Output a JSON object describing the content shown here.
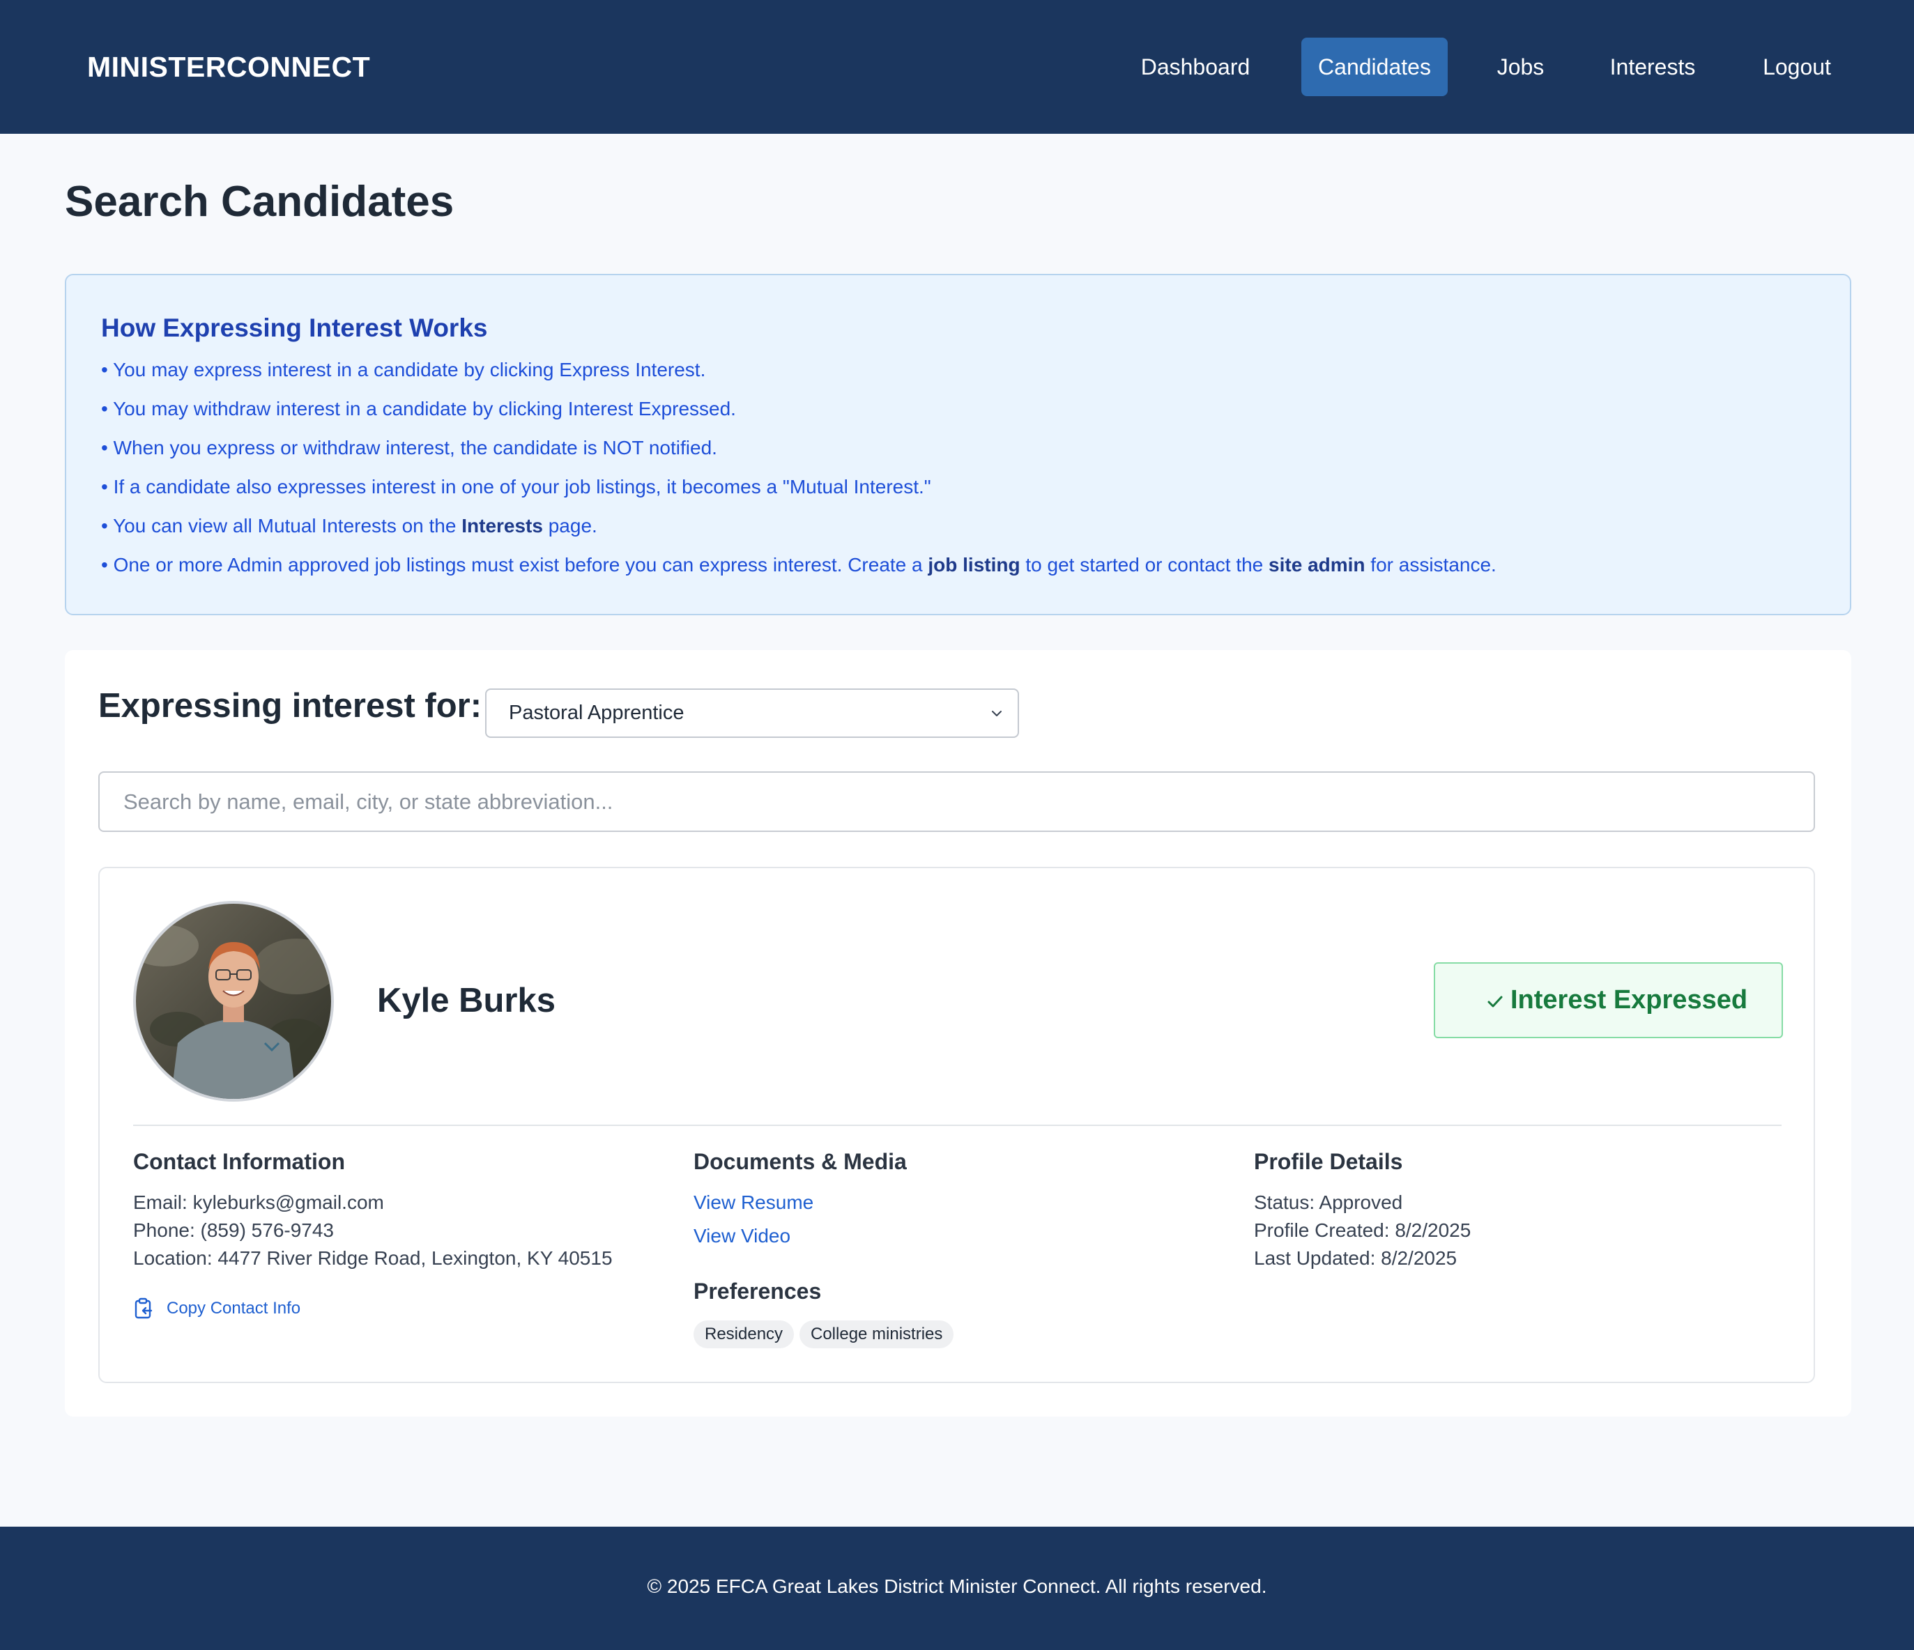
{
  "header": {
    "brand": "MINISTERCONNECT",
    "nav": [
      {
        "label": "Dashboard",
        "active": false
      },
      {
        "label": "Candidates",
        "active": true
      },
      {
        "label": "Jobs",
        "active": false
      },
      {
        "label": "Interests",
        "active": false
      },
      {
        "label": "Logout",
        "active": false
      }
    ],
    "bar_color": "#1b365e",
    "active_color": "#2e6bb0"
  },
  "page": {
    "title": "Search Candidates"
  },
  "info": {
    "title": "How Expressing Interest Works",
    "line1": "• You may express interest in a candidate by clicking Express Interest.",
    "line2": "• You may withdraw interest in a candidate by clicking Interest Expressed.",
    "line3": "• When you express or withdraw interest, the candidate is NOT notified.",
    "line4": "• If a candidate also expresses interest in one of your job listings, it becomes a \"Mutual Interest.\"",
    "line5_pre": "• You can view all Mutual Interests on the ",
    "line5_bold": "Interests",
    "line5_post": " page.",
    "line6_pre": "• One or more Admin approved job listings must exist before you can express interest. Create a ",
    "line6_bold1": "job listing",
    "line6_mid": " to get started or contact the ",
    "line6_bold2": "site admin",
    "line6_post": " for assistance."
  },
  "expressing": {
    "label": "Expressing interest for:",
    "selected_job": "Pastoral Apprentice"
  },
  "search": {
    "placeholder": "Search by name, email, city, or state abbreviation..."
  },
  "candidate": {
    "name": "Kyle Burks",
    "interest_button": "Interest Expressed",
    "contact": {
      "title": "Contact Information",
      "email": "Email: kyleburks@gmail.com",
      "phone": "Phone: (859) 576-9743",
      "location": "Location: 4477 River Ridge Road, Lexington, KY 40515",
      "copy_label": "Copy Contact Info"
    },
    "documents": {
      "title": "Documents & Media",
      "resume": "View Resume",
      "video": "View Video"
    },
    "preferences": {
      "title": "Preferences",
      "tags": [
        "Residency",
        "College ministries"
      ]
    },
    "profile": {
      "title": "Profile Details",
      "status": "Status: Approved",
      "created": "Profile Created: 8/2/2025",
      "updated": "Last Updated: 8/2/2025"
    }
  },
  "footer": {
    "text": "© 2025 EFCA Great Lakes District Minister Connect. All rights reserved."
  }
}
